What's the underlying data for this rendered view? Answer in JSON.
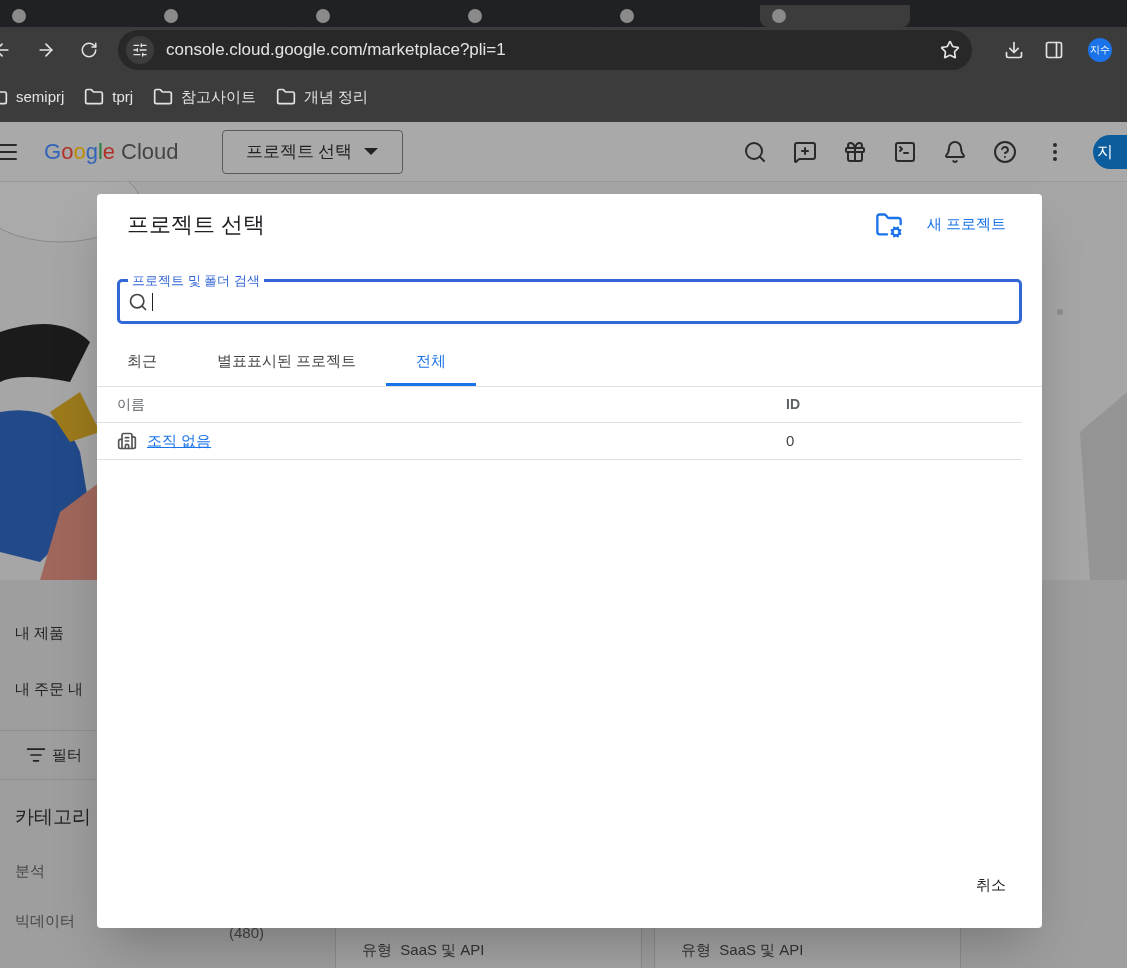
{
  "browser": {
    "tabs": [
      {
        "selected": false
      },
      {
        "selected": false
      },
      {
        "selected": false
      },
      {
        "selected": false
      },
      {
        "selected": false
      },
      {
        "selected": true
      }
    ],
    "url": "console.cloud.google.com/marketplace?pli=1",
    "profile": "지수",
    "bookmarks": [
      "semiprj",
      "tprj",
      "참고사이트",
      "개념 정리"
    ]
  },
  "console_header": {
    "logo_google": "Google",
    "logo_cloud": "Cloud",
    "project_picker": "프로젝트 선택",
    "avatar": "지"
  },
  "background": {
    "sidebar_items": [
      "내 제품",
      "내 주문 내"
    ],
    "filter": "필터",
    "category_title": "카테고리",
    "categories": [
      {
        "name": "분석"
      },
      {
        "name": "빅데이터",
        "count": "(480)"
      }
    ],
    "cards": [
      "유형  SaaS 및 API",
      "유형  SaaS 및 API"
    ]
  },
  "dialog": {
    "title": "프로젝트 선택",
    "new_project": "새 프로젝트",
    "search_label": "프로젝트 및 폴더 검색",
    "tabs": [
      {
        "label": "최근",
        "selected": false
      },
      {
        "label": "별표표시된 프로젝트",
        "selected": false
      },
      {
        "label": "전체",
        "selected": true
      }
    ],
    "columns": [
      "이름",
      "ID"
    ],
    "rows": [
      {
        "name": "조직 없음",
        "id": "0"
      }
    ],
    "cancel": "취소"
  }
}
